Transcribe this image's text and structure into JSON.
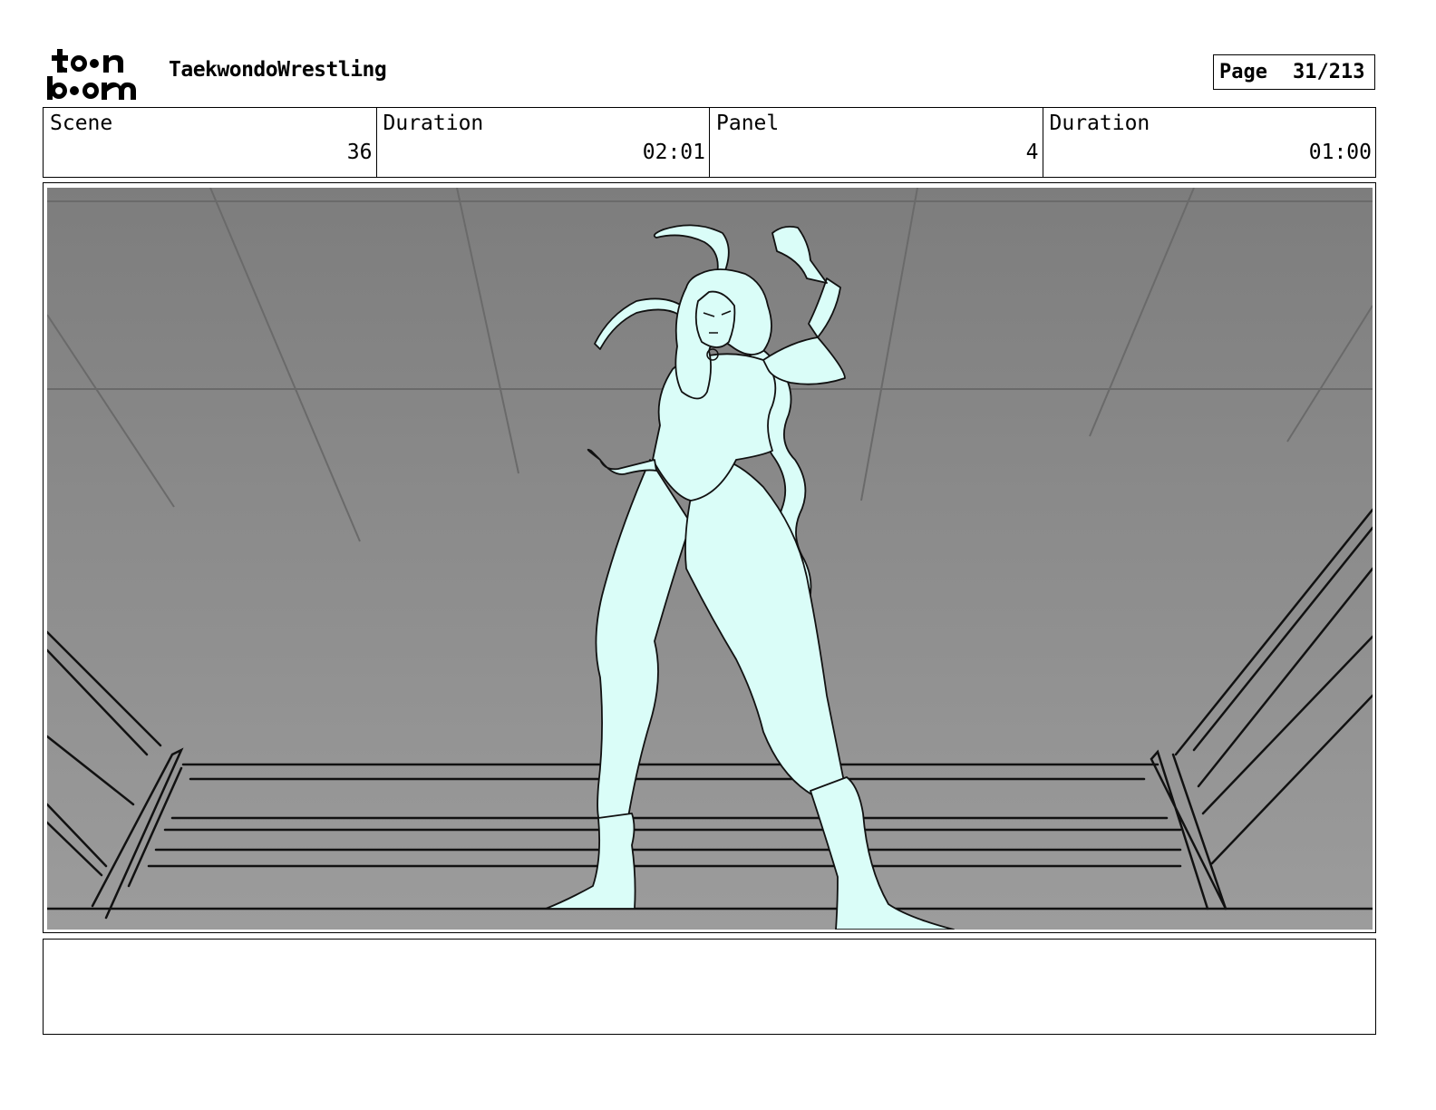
{
  "header": {
    "project_title": "TaekwondoWrestling",
    "page_label": "Page",
    "page_value": "31/213"
  },
  "info": {
    "scene_label": "Scene",
    "scene_value": "36",
    "scene_duration_label": "Duration",
    "scene_duration_value": "02:01",
    "panel_label": "Panel",
    "panel_value": "4",
    "panel_duration_label": "Duration",
    "panel_duration_value": "01:00"
  },
  "logo": {
    "text": "toon boom",
    "icon": "toon-boom-logo"
  },
  "colors": {
    "figure_fill": "#dafdf8",
    "background_gray": "#8f8f8f",
    "line": "#111111"
  },
  "notes": {
    "text": ""
  }
}
